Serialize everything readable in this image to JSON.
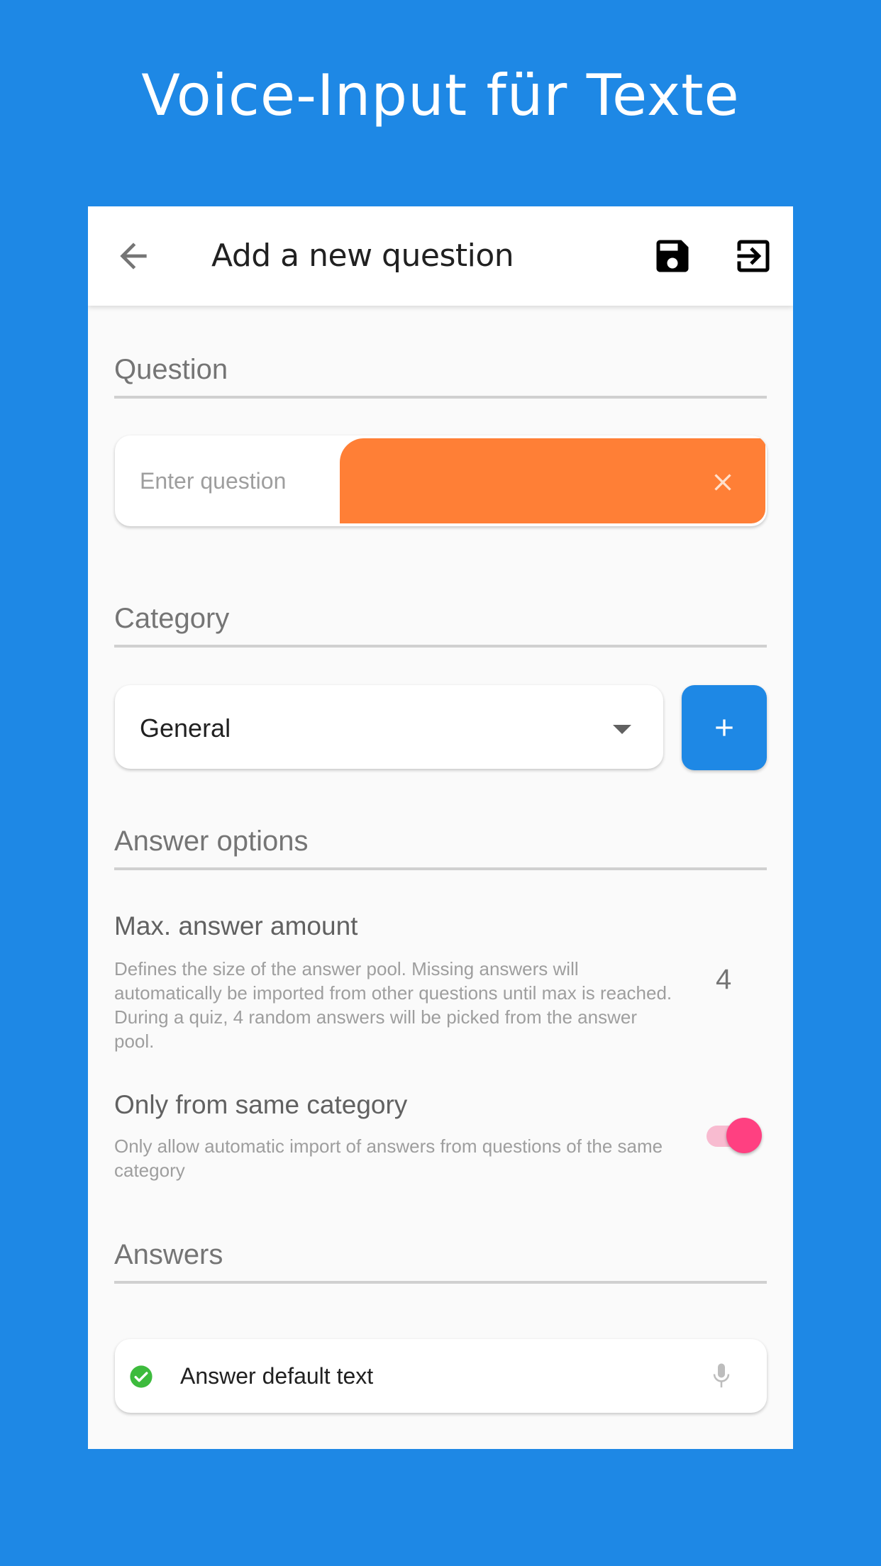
{
  "promo": {
    "title": "Voice-Input für Texte"
  },
  "appbar": {
    "title": "Add a new question",
    "icons": {
      "back": "arrow-back-icon",
      "save": "save-icon",
      "exit": "exit-to-app-icon"
    }
  },
  "sections": {
    "question": "Question",
    "category": "Category",
    "answer_options": "Answer options",
    "answers": "Answers"
  },
  "question_input": {
    "placeholder": "Enter question",
    "value": ""
  },
  "category": {
    "selected": "General",
    "add_icon": "plus-icon"
  },
  "options": {
    "max_answer": {
      "title": "Max. answer amount",
      "description": "Defines the size of the answer pool. Missing answers will automatically be imported from other questions until max is reached. During a quiz, 4 random answers will be picked from the answer pool.",
      "value": "4"
    },
    "same_category": {
      "title": "Only from same category",
      "description": "Only allow automatic import of answers from questions of the same category",
      "enabled": true
    }
  },
  "answers": [
    {
      "text": "Answer default text",
      "correct": true
    }
  ],
  "colors": {
    "background": "#1e88e5",
    "accent_orange": "#ff7f36",
    "toggle_pink": "#ff4081",
    "check_green": "#3dbb3d"
  }
}
